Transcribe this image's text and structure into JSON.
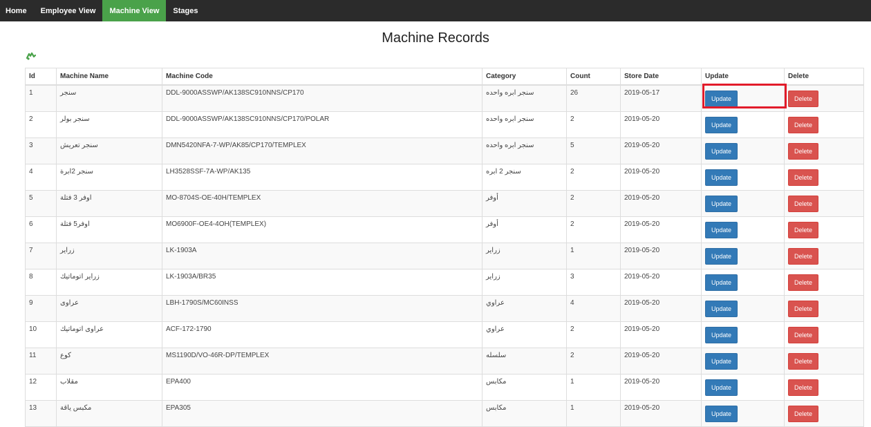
{
  "nav": {
    "items": [
      {
        "label": "Home",
        "active": false
      },
      {
        "label": "Employee View",
        "active": false
      },
      {
        "label": "Machine View",
        "active": true
      },
      {
        "label": "Stages",
        "active": false
      }
    ]
  },
  "page": {
    "title": "Machine Records",
    "add_icon": "add-machine-icon",
    "accent_color": "#4aa24a",
    "highlight_color": "#e21b2a"
  },
  "table": {
    "headers": [
      "Id",
      "Machine Name",
      "Machine Code",
      "Category",
      "Count",
      "Store Date",
      "Update",
      "Delete"
    ],
    "update_label": "Update",
    "delete_label": "Delete",
    "rows": [
      {
        "id": "1",
        "name": "سنجر",
        "code": "DDL-9000ASSWP/AK138SC910NNS/CP170",
        "category": "سنجر ابره واحده",
        "count": "26",
        "date": "2019-05-17"
      },
      {
        "id": "2",
        "name": "سنجر بولر",
        "code": "DDL-9000ASSWP/AK138SC910NNS/CP170/POLAR",
        "category": "سنجر ابره واحده",
        "count": "2",
        "date": "2019-05-20"
      },
      {
        "id": "3",
        "name": "سنجر تعريش",
        "code": "DMN5420NFA-7-WP/AK85/CP170/TEMPLEX",
        "category": "سنجر ابره واحده",
        "count": "5",
        "date": "2019-05-20"
      },
      {
        "id": "4",
        "name": "سنجر 2ابرة",
        "code": "LH3528SSF-7A-WP/AK135",
        "category": "سنجر 2 ابره",
        "count": "2",
        "date": "2019-05-20"
      },
      {
        "id": "5",
        "name": "اوفر 3 فتلة",
        "code": "MO-8704S-OE-40H/TEMPLEX",
        "category": "أوفر",
        "count": "2",
        "date": "2019-05-20"
      },
      {
        "id": "6",
        "name": "اوفر5 فتلة",
        "code": "MO6900F-OE4-4OH(TEMPLEX)",
        "category": "أوفر",
        "count": "2",
        "date": "2019-05-20"
      },
      {
        "id": "7",
        "name": "زراير",
        "code": "LK-1903A",
        "category": "زراير",
        "count": "1",
        "date": "2019-05-20"
      },
      {
        "id": "8",
        "name": "زراير اتوماتيك",
        "code": "LK-1903A/BR35",
        "category": "زراير",
        "count": "3",
        "date": "2019-05-20"
      },
      {
        "id": "9",
        "name": "عراوى",
        "code": "LBH-1790S/MC60INSS",
        "category": "عراوي",
        "count": "4",
        "date": "2019-05-20"
      },
      {
        "id": "10",
        "name": "عراوى اتوماتيك",
        "code": "ACF-172-1790",
        "category": "عراوي",
        "count": "2",
        "date": "2019-05-20"
      },
      {
        "id": "11",
        "name": "كوع",
        "code": "MS1190D/VO-46R-DP/TEMPLEX",
        "category": "سلسله",
        "count": "2",
        "date": "2019-05-20"
      },
      {
        "id": "12",
        "name": "مقلاب",
        "code": "EPA400",
        "category": "مكابس",
        "count": "1",
        "date": "2019-05-20"
      },
      {
        "id": "13",
        "name": "مكبس ياقة",
        "code": "EPA305",
        "category": "مكابس",
        "count": "1",
        "date": "2019-05-20"
      }
    ]
  }
}
